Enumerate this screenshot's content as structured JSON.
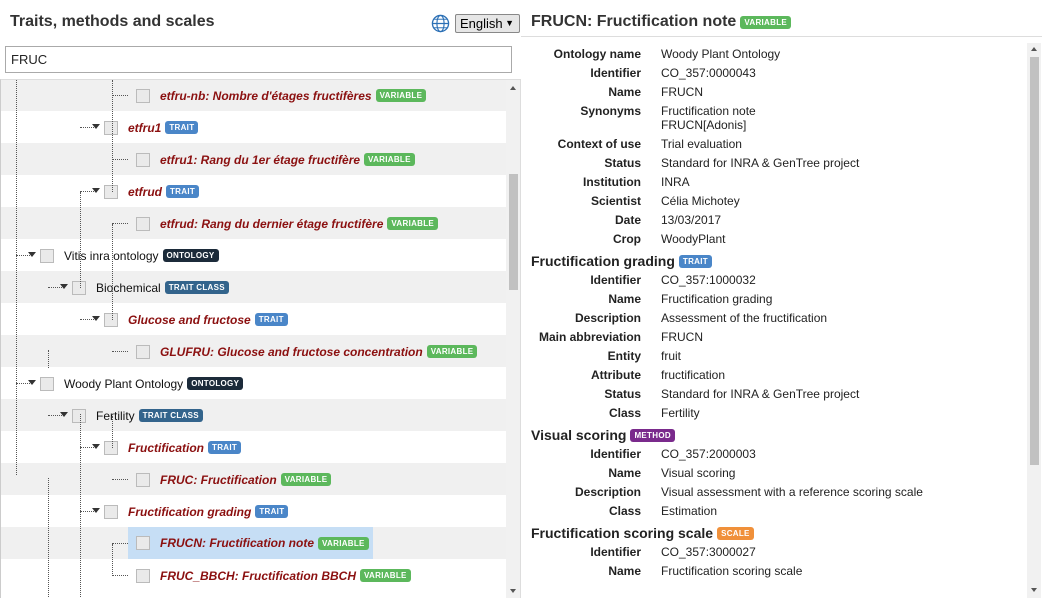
{
  "left": {
    "title": "Traits, methods and scales",
    "language": "English",
    "search_value": "FRUC"
  },
  "tree": {
    "rows": [
      {
        "label": "etfru-nb: Nombre d'étages fructifères",
        "badge": "VARIABLE",
        "kind": "variable"
      },
      {
        "label": "etfru1",
        "badge": "TRAIT",
        "kind": "trait"
      },
      {
        "label": "etfru1: Rang du 1er étage fructifère",
        "badge": "VARIABLE",
        "kind": "variable"
      },
      {
        "label": "etfrud",
        "badge": "TRAIT",
        "kind": "trait"
      },
      {
        "label": "etfrud: Rang du dernier étage fructifère",
        "badge": "VARIABLE",
        "kind": "variable"
      },
      {
        "label": "Vitis inra ontology",
        "badge": "ONTOLOGY",
        "kind": "ontology"
      },
      {
        "label": "Biochemical",
        "badge": "TRAIT CLASS",
        "kind": "trait-class"
      },
      {
        "label": "Glucose and fructose",
        "badge": "TRAIT",
        "kind": "trait"
      },
      {
        "label": "GLUFRU: Glucose and fructose concentration",
        "badge": "VARIABLE",
        "kind": "variable"
      },
      {
        "label": "Woody Plant Ontology",
        "badge": "ONTOLOGY",
        "kind": "ontology"
      },
      {
        "label": "Fertility",
        "badge": "TRAIT CLASS",
        "kind": "trait-class"
      },
      {
        "label": "Fructification",
        "badge": "TRAIT",
        "kind": "trait"
      },
      {
        "label": "FRUC: Fructification",
        "badge": "VARIABLE",
        "kind": "variable"
      },
      {
        "label": "Fructification grading",
        "badge": "TRAIT",
        "kind": "trait"
      },
      {
        "label": "FRUCN: Fructification note",
        "badge": "VARIABLE",
        "kind": "variable",
        "selected": true
      },
      {
        "label": "FRUC_BBCH: Fructification BBCH",
        "badge": "VARIABLE",
        "kind": "variable"
      }
    ]
  },
  "detail": {
    "title": "FRUCN: Fructification note",
    "title_badge": "VARIABLE",
    "variable": [
      {
        "k": "Ontology name",
        "v": "Woody Plant Ontology"
      },
      {
        "k": "Identifier",
        "v": "CO_357:0000043"
      },
      {
        "k": "Name",
        "v": "FRUCN"
      },
      {
        "k": "Synonyms",
        "v": "Fructification note\nFRUCN[Adonis]"
      },
      {
        "k": "Context of use",
        "v": "Trial evaluation"
      },
      {
        "k": "Status",
        "v": "Standard for INRA & GenTree project"
      },
      {
        "k": "Institution",
        "v": "INRA"
      },
      {
        "k": "Scientist",
        "v": "Célia Michotey"
      },
      {
        "k": "Date",
        "v": "13/03/2017"
      },
      {
        "k": "Crop",
        "v": "WoodyPlant"
      }
    ],
    "trait_title": "Fructification grading",
    "trait_badge": "TRAIT",
    "trait": [
      {
        "k": "Identifier",
        "v": "CO_357:1000032"
      },
      {
        "k": "Name",
        "v": "Fructification grading"
      },
      {
        "k": "Description",
        "v": "Assessment of the fructification"
      },
      {
        "k": "Main abbreviation",
        "v": "FRUCN"
      },
      {
        "k": "Entity",
        "v": "fruit"
      },
      {
        "k": "Attribute",
        "v": "fructification"
      },
      {
        "k": "Status",
        "v": "Standard for INRA & GenTree project"
      },
      {
        "k": "Class",
        "v": "Fertility"
      }
    ],
    "method_title": "Visual scoring",
    "method_badge": "METHOD",
    "method": [
      {
        "k": "Identifier",
        "v": "CO_357:2000003"
      },
      {
        "k": "Name",
        "v": "Visual scoring"
      },
      {
        "k": "Description",
        "v": "Visual assessment with a reference scoring scale"
      },
      {
        "k": "Class",
        "v": "Estimation"
      }
    ],
    "scale_title": "Fructification scoring scale",
    "scale_badge": "SCALE",
    "scale": [
      {
        "k": "Identifier",
        "v": "CO_357:3000027"
      },
      {
        "k": "Name",
        "v": "Fructification scoring scale"
      }
    ]
  }
}
